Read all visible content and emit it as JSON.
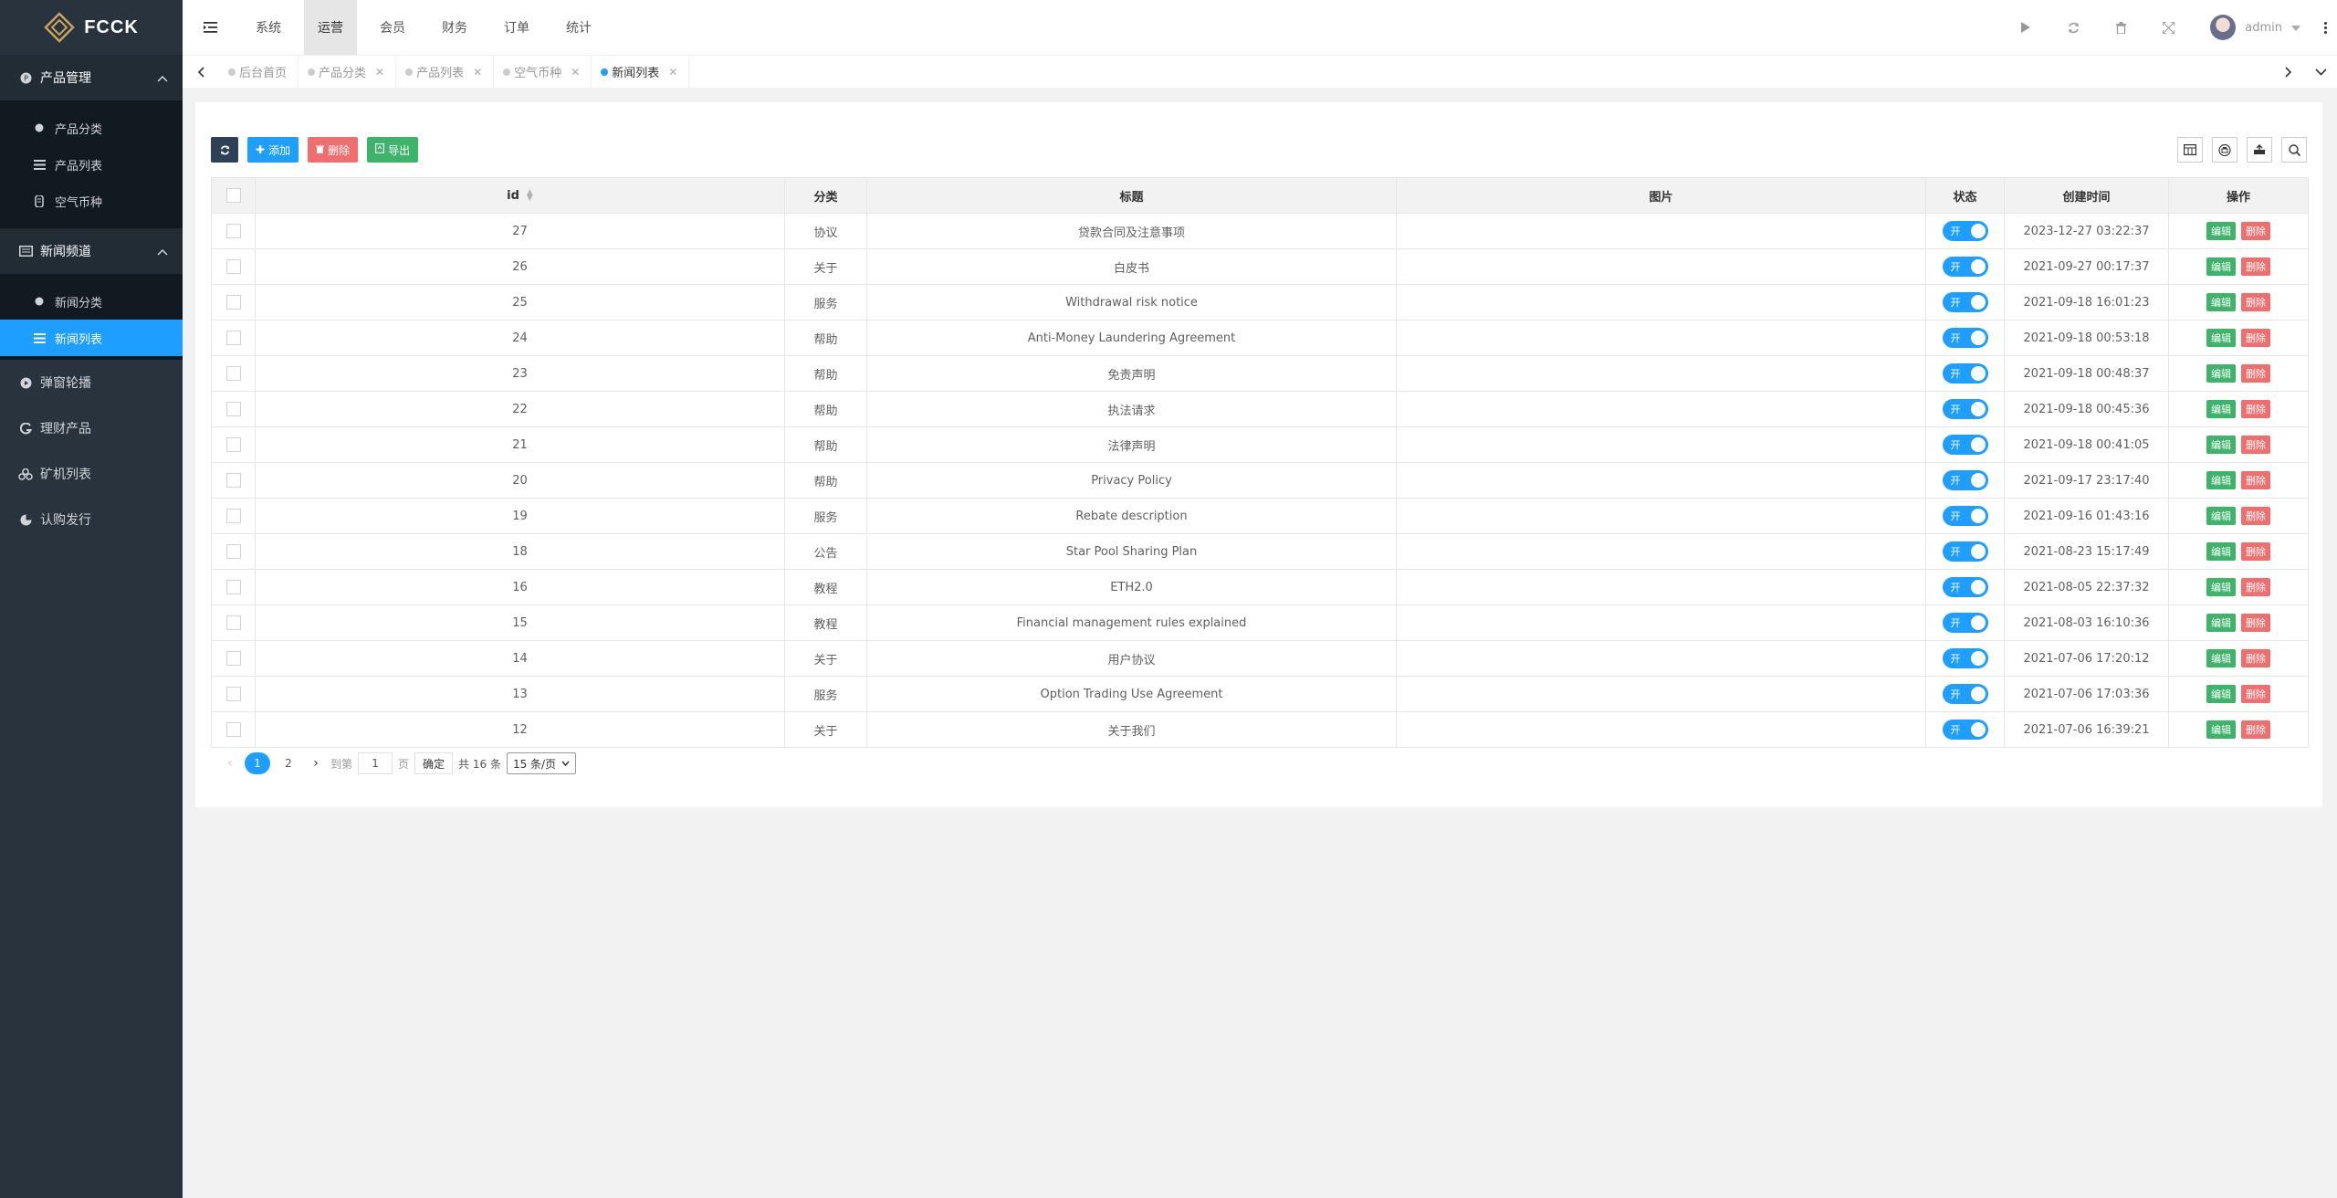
{
  "brand": {
    "name": "FCCK"
  },
  "sidebar": {
    "groups": [
      {
        "label": "产品管理",
        "icon": "product-icon",
        "expanded": true,
        "items": [
          {
            "label": "产品分类",
            "icon": "dot-icon"
          },
          {
            "label": "产品列表",
            "icon": "list-icon"
          },
          {
            "label": "空气币种",
            "icon": "coin-icon"
          }
        ]
      },
      {
        "label": "新闻频道",
        "icon": "news-icon",
        "expanded": true,
        "items": [
          {
            "label": "新闻分类",
            "icon": "dot-icon"
          },
          {
            "label": "新闻列表",
            "icon": "list-icon",
            "active": true
          }
        ]
      }
    ],
    "items": [
      {
        "label": "弹窗轮播",
        "icon": "carousel-icon"
      },
      {
        "label": "理财产品",
        "icon": "finance-icon"
      },
      {
        "label": "矿机列表",
        "icon": "miner-icon"
      },
      {
        "label": "认购发行",
        "icon": "pie-icon"
      }
    ]
  },
  "header": {
    "menu": [
      "系统",
      "运营",
      "会员",
      "财务",
      "订单",
      "统计"
    ],
    "active_menu": "运营",
    "user": "admin"
  },
  "tabs": [
    {
      "label": "后台首页",
      "closable": false
    },
    {
      "label": "产品分类",
      "closable": true
    },
    {
      "label": "产品列表",
      "closable": true
    },
    {
      "label": "空气币种",
      "closable": true
    },
    {
      "label": "新闻列表",
      "closable": true,
      "active": true
    }
  ],
  "toolbar": {
    "add_label": "添加",
    "delete_label": "删除",
    "export_label": "导出"
  },
  "table": {
    "columns": [
      "id",
      "分类",
      "标题",
      "图片",
      "状态",
      "创建时间",
      "操作"
    ],
    "switch_label": "开",
    "edit_label": "编辑",
    "delete_label": "删除",
    "rows": [
      {
        "id": "27",
        "category": "协议",
        "title": "贷款合同及注意事项",
        "created": "2023-12-27 03:22:37"
      },
      {
        "id": "26",
        "category": "关于",
        "title": "白皮书",
        "created": "2021-09-27 00:17:37"
      },
      {
        "id": "25",
        "category": "服务",
        "title": "Withdrawal risk notice",
        "created": "2021-09-18 16:01:23"
      },
      {
        "id": "24",
        "category": "帮助",
        "title": "Anti-Money Laundering Agreement",
        "created": "2021-09-18 00:53:18"
      },
      {
        "id": "23",
        "category": "帮助",
        "title": "免责声明",
        "created": "2021-09-18 00:48:37"
      },
      {
        "id": "22",
        "category": "帮助",
        "title": "执法请求",
        "created": "2021-09-18 00:45:36"
      },
      {
        "id": "21",
        "category": "帮助",
        "title": "法律声明",
        "created": "2021-09-18 00:41:05"
      },
      {
        "id": "20",
        "category": "帮助",
        "title": "Privacy Policy",
        "created": "2021-09-17 23:17:40"
      },
      {
        "id": "19",
        "category": "服务",
        "title": "Rebate description",
        "created": "2021-09-16 01:43:16"
      },
      {
        "id": "18",
        "category": "公告",
        "title": "Star Pool Sharing Plan",
        "created": "2021-08-23 15:17:49"
      },
      {
        "id": "16",
        "category": "教程",
        "title": "ETH2.0",
        "created": "2021-08-05 22:37:32"
      },
      {
        "id": "15",
        "category": "教程",
        "title": "Financial management rules explained",
        "created": "2021-08-03 16:10:36"
      },
      {
        "id": "14",
        "category": "关于",
        "title": "用户协议",
        "created": "2021-07-06 17:20:12"
      },
      {
        "id": "13",
        "category": "服务",
        "title": "Option Trading Use Agreement",
        "created": "2021-07-06 17:03:36"
      },
      {
        "id": "12",
        "category": "关于",
        "title": "关于我们",
        "created": "2021-07-06 16:39:21"
      }
    ]
  },
  "pager": {
    "pages": [
      "1",
      "2"
    ],
    "current": "1",
    "goto_label": "到第",
    "page_value": "1",
    "page_unit": "页",
    "confirm_label": "确定",
    "total_label": "共 16 条",
    "per_page": "15 条/页"
  },
  "colors": {
    "accent": "#1e9fff",
    "sidebar": "#28333e",
    "edit": "#3eb36a",
    "delete": "#ef6e6e"
  }
}
